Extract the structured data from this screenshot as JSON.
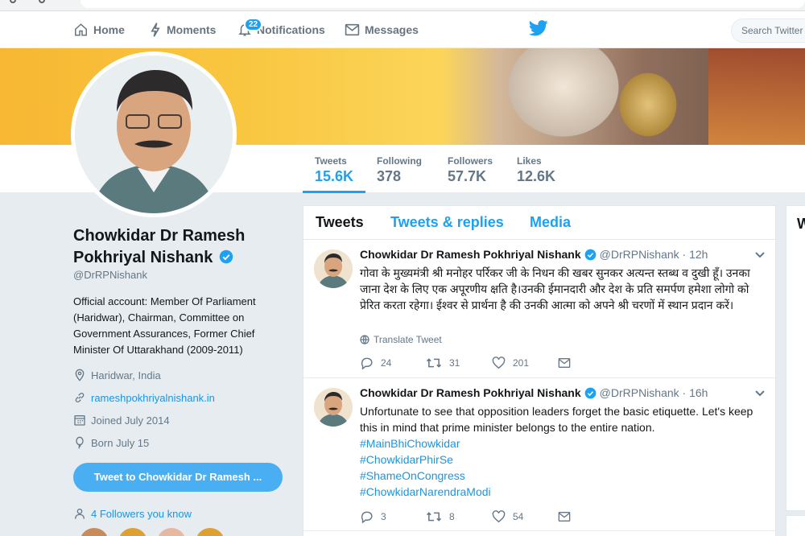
{
  "nav": {
    "home": "Home",
    "moments": "Moments",
    "notifications": "Notifications",
    "notifications_badge": "22",
    "messages": "Messages",
    "search_placeholder": "Search Twitter"
  },
  "profile_stats": [
    {
      "label": "Tweets",
      "value": "15.6K"
    },
    {
      "label": "Following",
      "value": "378"
    },
    {
      "label": "Followers",
      "value": "57.7K"
    },
    {
      "label": "Likes",
      "value": "12.6K"
    }
  ],
  "profile": {
    "name": "Chowkidar Dr Ramesh Pokhriyal Nishank",
    "handle": "@DrRPNishank",
    "bio": "Official account: Member Of Parliament (Haridwar), Chairman, Committee on Government Assurances, Former Chief Minister Of Uttarakhand (2009-2011)",
    "location": "Haridwar, India",
    "website": "rameshpokhriyalnishank.in",
    "joined": "Joined July 2014",
    "born": "Born July 15",
    "tweet_to_button": "Tweet to Chowkidar Dr Ramesh ...",
    "followers_you_know": "4 Followers you know"
  },
  "timeline": {
    "tabs": [
      "Tweets",
      "Tweets & replies",
      "Media"
    ],
    "tweets": [
      {
        "name": "Chowkidar Dr Ramesh Pokhriyal Nishank",
        "handle": "@DrRPNishank · 12h",
        "text": "गोवा के मुख्यमंत्री श्री मनोहर पर्रिकर जी के निधन की खबर सुनकर अत्यन्त स्तब्ध व दुखी हूँ। उनका जाना देश के लिए एक अपूरणीय क्षति है।उनकी ईमानदारी और देश के प्रति समर्पण हमेशा लोगो को प्रेरित करता रहेगा।  ईश्वर से प्रार्थना है की उनकी आत्मा को अपने श्री चरणों में स्थान प्रदान करें।",
        "translate": "Translate Tweet",
        "replies": "24",
        "retweets": "31",
        "likes": "201"
      },
      {
        "name": "Chowkidar Dr Ramesh Pokhriyal Nishank",
        "handle": "@DrRPNishank · 16h",
        "text": "Unfortunate to see that opposition leaders forget the basic etiquette. Let's keep this in mind that prime minister belongs to the entire nation.",
        "hashtags": [
          "#MainBhiChowkidar",
          "#ChowkidarPhirSe",
          "#ShameOnCongress",
          "#ChowkidarNarendraModi"
        ],
        "replies": "3",
        "retweets": "8",
        "likes": "54"
      }
    ]
  },
  "right_sidebar": {
    "heading_initial": "W"
  },
  "colors": {
    "accent": "#1da1f2",
    "link": "#1b95e0",
    "background": "#e6ecf0"
  },
  "icons": [
    "home-icon",
    "moments-icon",
    "notifications-icon",
    "messages-icon",
    "twitter-bird-icon",
    "verified-icon",
    "location-icon",
    "link-icon",
    "calendar-icon",
    "balloon-icon",
    "people-icon",
    "globe-icon",
    "reply-icon",
    "retweet-icon",
    "like-icon",
    "dm-icon",
    "chevron-down-icon"
  ]
}
